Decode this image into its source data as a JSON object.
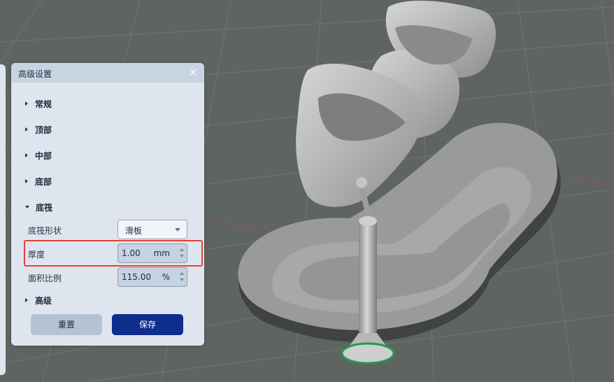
{
  "panel": {
    "title": "高级设置",
    "close_icon": "×",
    "sections": {
      "general": "常规",
      "top": "顶部",
      "middle": "中部",
      "bottom": "底部",
      "base": "底筏",
      "advanced": "高级"
    },
    "base_fields": {
      "shape_label": "底筏形状",
      "shape_value": "滑板",
      "thickness_label": "厚度",
      "thickness_value": "1.00",
      "thickness_unit": "mm",
      "area_ratio_label": "面积比例",
      "area_ratio_value": "115.00",
      "area_ratio_unit": "%"
    },
    "buttons": {
      "reset": "重置",
      "save": "保存"
    }
  },
  "colors": {
    "viewport_background": "#5d6462",
    "panel_background": "#dfe5ee",
    "save_button": "#0f2d8c",
    "highlight": "#e0433a"
  }
}
